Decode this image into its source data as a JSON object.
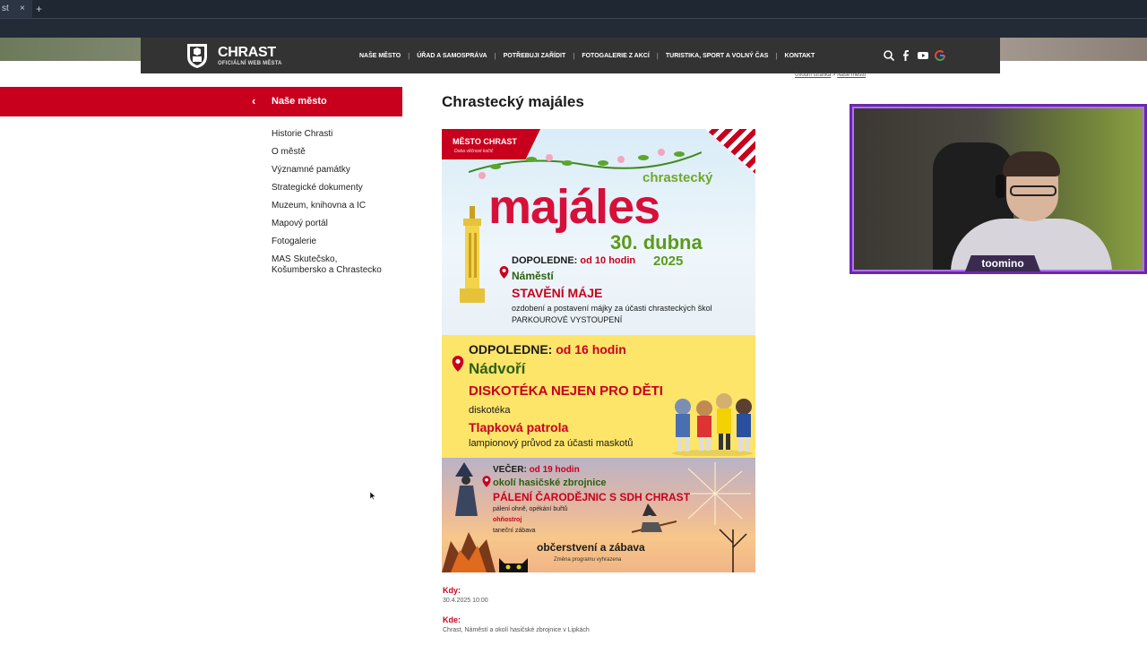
{
  "browser": {
    "tab_label": "st",
    "tab_close": "×",
    "new_tab": "+"
  },
  "site": {
    "brand": "CHRAST",
    "brand_sub": "OFICIÁLNÍ WEB MĚSTA",
    "nav": [
      {
        "label": "NAŠE MĚSTO"
      },
      {
        "label": "ÚŘAD A SAMOSPRÁVA"
      },
      {
        "label": "POTŘEBUJI ZAŘÍDIT"
      },
      {
        "label": "FOTOGALERIE Z AKCÍ"
      },
      {
        "label": "TURISTIKA, SPORT A VOLNÝ ČAS"
      },
      {
        "label": "KONTAKT"
      }
    ],
    "icons": [
      "search-icon",
      "facebook-icon",
      "youtube-icon",
      "google-icon"
    ]
  },
  "breadcrumb": {
    "home": "Úvodní stránka",
    "sep": ">",
    "current": "Naše město"
  },
  "sidebar": {
    "title": "Naše město",
    "back_glyph": "‹",
    "items": [
      {
        "label": "Historie Chrasti"
      },
      {
        "label": "O městě"
      },
      {
        "label": "Významné památky"
      },
      {
        "label": "Strategické dokumenty"
      },
      {
        "label": "Muzeum, knihovna a IC"
      },
      {
        "label": "Mapový portál"
      },
      {
        "label": "Fotogalerie"
      },
      {
        "label": "MAS Skutečsko,"
      },
      {
        "label": "Košumbersko a Chrastecko"
      }
    ]
  },
  "main": {
    "title": "Chrastecký majáles",
    "poster": {
      "ribbon": "MĚSTO CHRAST",
      "ribbon_sub": "Doba věčnost kočič",
      "chrastecky": "chrastecký",
      "majales": "majáles",
      "date": "30. dubna",
      "year": "2025",
      "morning_label": "DOPOLEDNE:",
      "morning_time": "od 10 hodin",
      "morning_place": "Náměstí",
      "morning_event": "STAVĚNÍ MÁJE",
      "morning_desc": "ozdobení a postavení májky za účasti chrasteckých škol",
      "morning_desc2": "PARKOUROVÉ VYSTOUPENÍ",
      "afternoon_label": "ODPOLEDNE:",
      "afternoon_time": "od 16 hodin",
      "afternoon_place": "Nádvoří",
      "afternoon_event": "DISKOTÉKA NEJEN PRO DĚTI",
      "afternoon_desc": "diskotéka",
      "afternoon_special": "Tlapková patrola",
      "afternoon_desc2": "lampionový průvod za účasti maskotů",
      "evening_label": "VEČER:",
      "evening_time": "od 19 hodin",
      "evening_place": "okolí hasičské zbrojnice",
      "evening_event": "PÁLENÍ ČARODĚJNIC S SDH CHRAST",
      "evening_desc1": "pálení ohně, opékání buřtů",
      "evening_desc2": "ohňostroj",
      "evening_desc3": "taneční zábava",
      "refresh": "občerstvení a zábava",
      "note": "Změna programu vyhrazena"
    },
    "when_label": "Kdy:",
    "when_value": "30.4.2025 10:00",
    "where_label": "Kde:",
    "where_value": "Chrast, Náměstí a okolí hasičské zbrojnice v Lipkách"
  },
  "webcam": {
    "name": "toomino"
  },
  "colors": {
    "brand_red": "#c8001e",
    "nav_bg": "#333333",
    "poster_green": "#5a9b1c",
    "webcam_border": "#6a28a8"
  }
}
